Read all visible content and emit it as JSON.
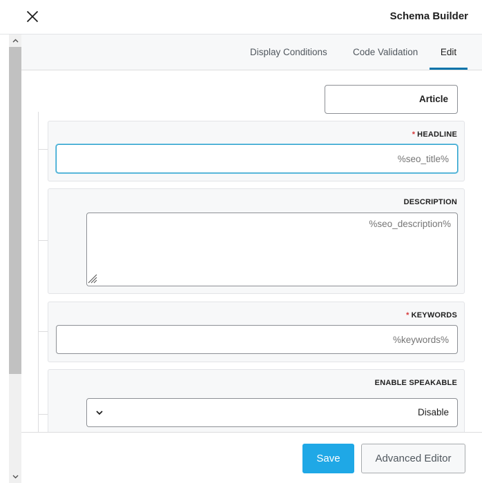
{
  "header": {
    "title": "Schema Builder",
    "close_icon": "close-icon"
  },
  "tabs": [
    {
      "label": "Display Conditions",
      "active": false
    },
    {
      "label": "Code Validation",
      "active": false
    },
    {
      "label": "Edit",
      "active": true
    }
  ],
  "schema_type": {
    "value": "Article"
  },
  "fields": {
    "headline": {
      "label": "HEADLINE",
      "required_mark": "*",
      "placeholder": "%seo_title%",
      "focused": true
    },
    "description": {
      "label": "DESCRIPTION",
      "placeholder": "%seo_description%"
    },
    "keywords": {
      "label": "KEYWORDS",
      "required_mark": "*",
      "placeholder": "%keywords%"
    },
    "enable_speakable": {
      "label": "ENABLE SPEAKABLE",
      "selected": "Disable",
      "chevron_icon": "chevron-down-icon"
    }
  },
  "footer": {
    "save_label": "Save",
    "advanced_editor_label": "Advanced Editor"
  },
  "colors": {
    "accent": "#0073aa",
    "save_button": "#1fa8e6",
    "required": "#d63638",
    "focus_border": "#2ea2cc"
  }
}
